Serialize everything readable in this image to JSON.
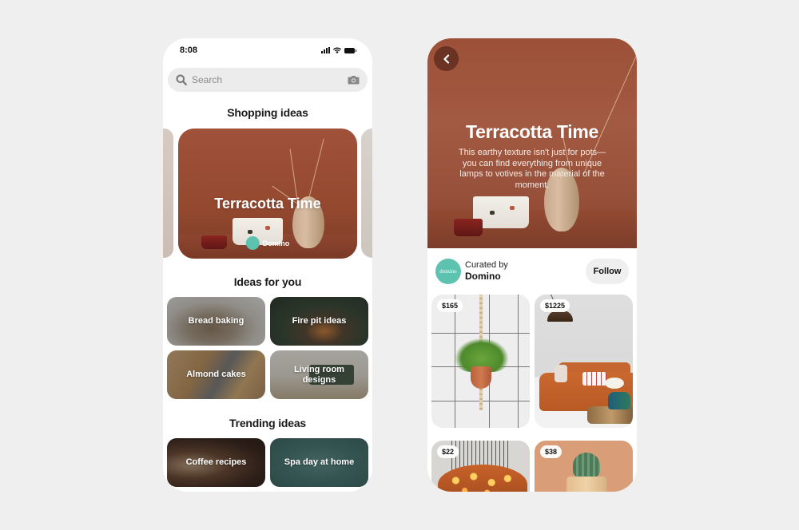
{
  "left_phone": {
    "status_bar": {
      "time": "8:08",
      "icons": [
        "signal-icon",
        "wifi-icon",
        "battery-icon"
      ]
    },
    "search": {
      "placeholder": "Search",
      "leading_icon": "search-icon",
      "trailing_icon": "camera-icon"
    },
    "shopping_ideas": {
      "title": "Shopping ideas",
      "featured": {
        "title": "Terracotta Time",
        "curator": "Domino"
      }
    },
    "ideas_for_you": {
      "title": "Ideas for you",
      "items": [
        {
          "label": "Bread baking"
        },
        {
          "label": "Fire pit ideas"
        },
        {
          "label": "Almond cakes"
        },
        {
          "label": "Living room designs"
        }
      ]
    },
    "trending_ideas": {
      "title": "Trending ideas",
      "items": [
        {
          "label": "Coffee recipes"
        },
        {
          "label": "Spa day at home"
        }
      ]
    }
  },
  "right_phone": {
    "back_icon": "chevron-left-icon",
    "hero": {
      "title": "Terracotta Time",
      "description": "This earthy texture isn't just for pots—you can find everything from unique lamps to votives in the material of the moment."
    },
    "curator": {
      "label": "Curated by",
      "name": "Domino",
      "avatar_text": "domino",
      "follow_label": "Follow"
    },
    "products": [
      {
        "price": "$165",
        "subject": "macrame-planter"
      },
      {
        "price": "$1225",
        "subject": "orange-sofa"
      },
      {
        "price": "$22",
        "subject": "pendant-lights"
      },
      {
        "price": "$38",
        "subject": "potted-cactus"
      }
    ]
  },
  "colors": {
    "background": "#efefef",
    "terracotta": "#9c5038",
    "domino_teal": "#5ec2b0",
    "follow_button_bg": "#efefef"
  }
}
